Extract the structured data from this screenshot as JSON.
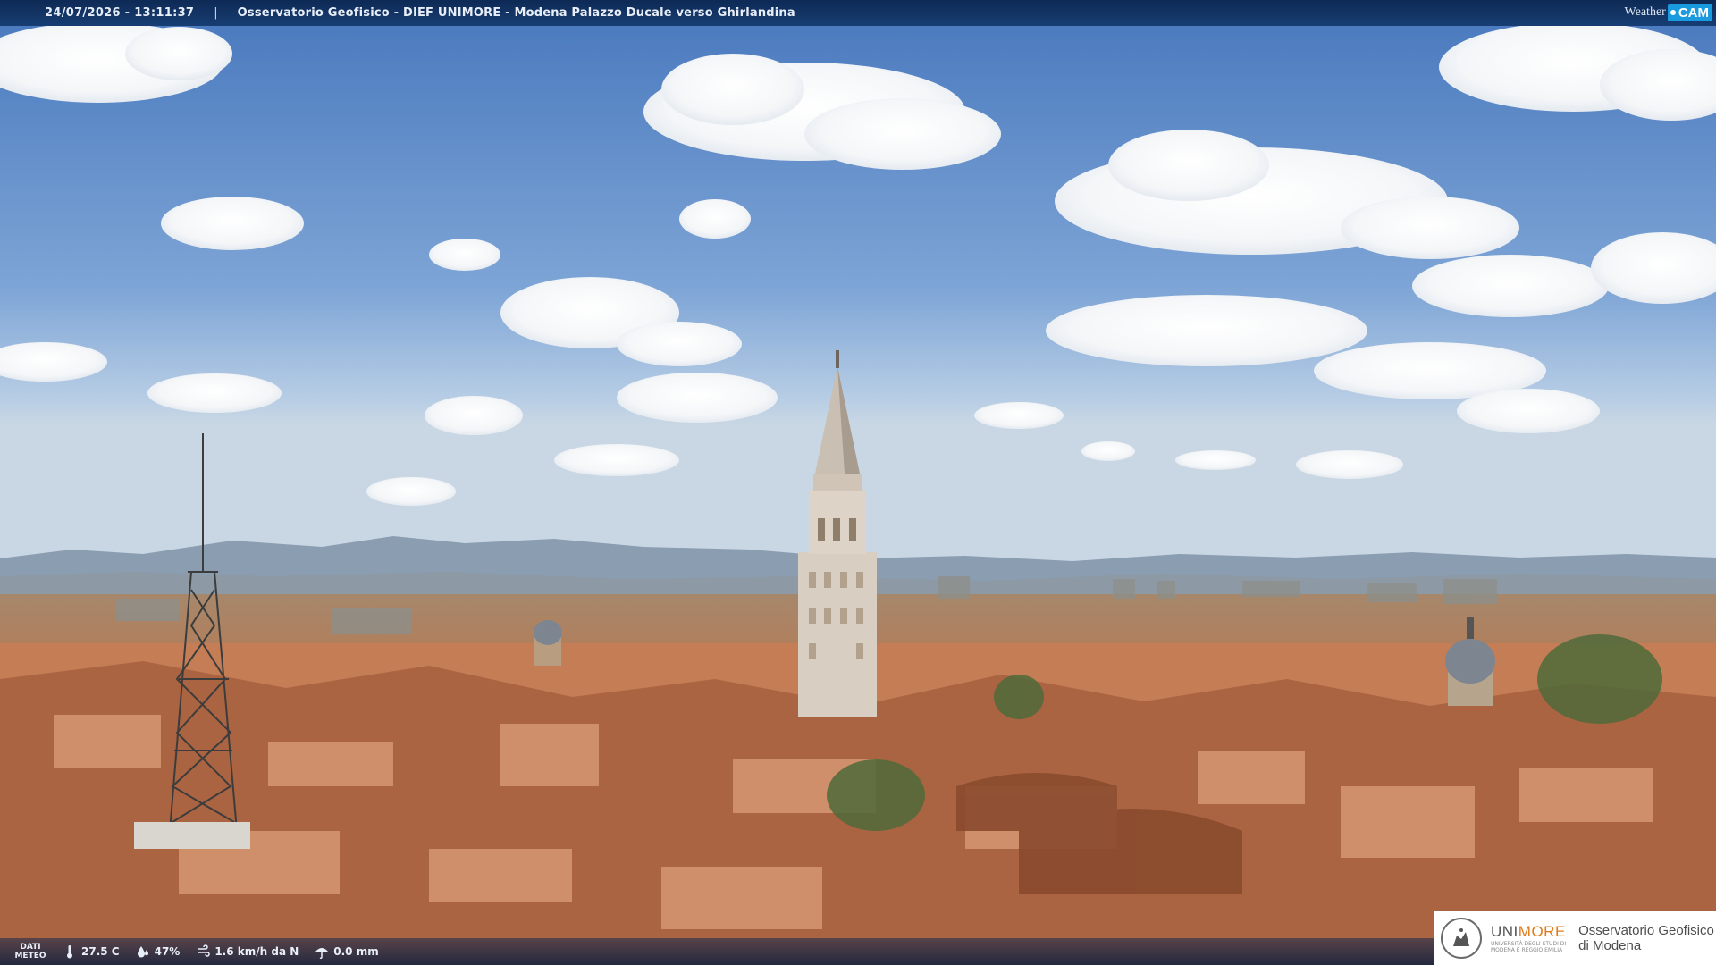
{
  "header": {
    "timestamp": "24/07/2026 - 13:11:37",
    "separator": "|",
    "title": "Osservatorio Geofisico - DIEF UNIMORE - Modena Palazzo Ducale verso Ghirlandina"
  },
  "brand_logo": {
    "weather": "Weather",
    "cam": "CAM"
  },
  "weather": {
    "label_line1": "DATI",
    "label_line2": "METEO",
    "temperature": "27.5 C",
    "humidity": "47%",
    "wind": "1.6 km/h da N",
    "rain": "0.0 mm",
    "icons": [
      "thermometer-icon",
      "humidity-icon",
      "wind-icon",
      "rain-icon"
    ]
  },
  "institution": {
    "name_part1": "UNI",
    "name_part2": "MORE",
    "name_small_line1": "UNIVERSITÀ DEGLI STUDI DI",
    "name_small_line2": "MODENA E REGGIO EMILIA",
    "observatory_line1": "Osservatorio Geofisico",
    "observatory_line2": "di Modena"
  },
  "colors": {
    "sky_top": "#4f7fc2",
    "sky_bottom": "#bfd3e6",
    "roof": "#b8704a",
    "tower": "#d9cfc2",
    "accent_orange": "#e07a1a"
  }
}
